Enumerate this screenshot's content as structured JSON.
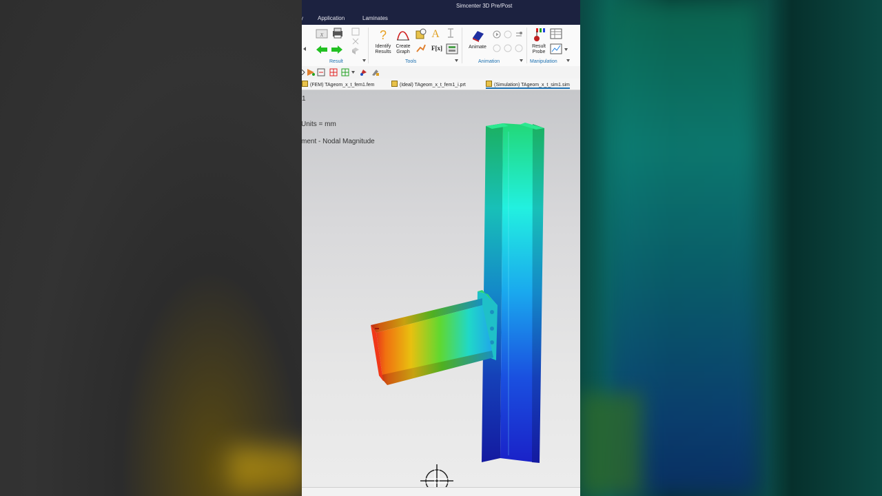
{
  "window": {
    "title": "Simcenter 3D Pre/Post",
    "menu_cut": "y",
    "menus": [
      "Application",
      "Laminates"
    ]
  },
  "ribbon": {
    "groups": [
      {
        "label": "Result"
      },
      {
        "label": "Tools"
      },
      {
        "label": "Animation"
      },
      {
        "label": "Manipulation"
      }
    ],
    "buttons": {
      "identify_results": "Identify\nResults",
      "create_graph": "Create\nGraph",
      "animate": "Animate",
      "result_probe": "Result\nProbe",
      "fx": "F[x]"
    }
  },
  "tabs": [
    {
      "label": "(FEM) TAgeom_x_t_fem1.fem"
    },
    {
      "label": "(Ideal) TAgeom_x_t_fem1_i.prt"
    },
    {
      "label": "(Simulation) TAgeom_x_t_sim1.sim",
      "active": true
    }
  ],
  "viewport": {
    "line1": "1",
    "line2": "Units = mm",
    "line3": "ment - Nodal Magnitude"
  },
  "colors": {
    "titlebar": "#1c2240",
    "accent": "#1a6fb0",
    "contour_low": "#1a2ed6",
    "contour_high": "#e8281a"
  }
}
